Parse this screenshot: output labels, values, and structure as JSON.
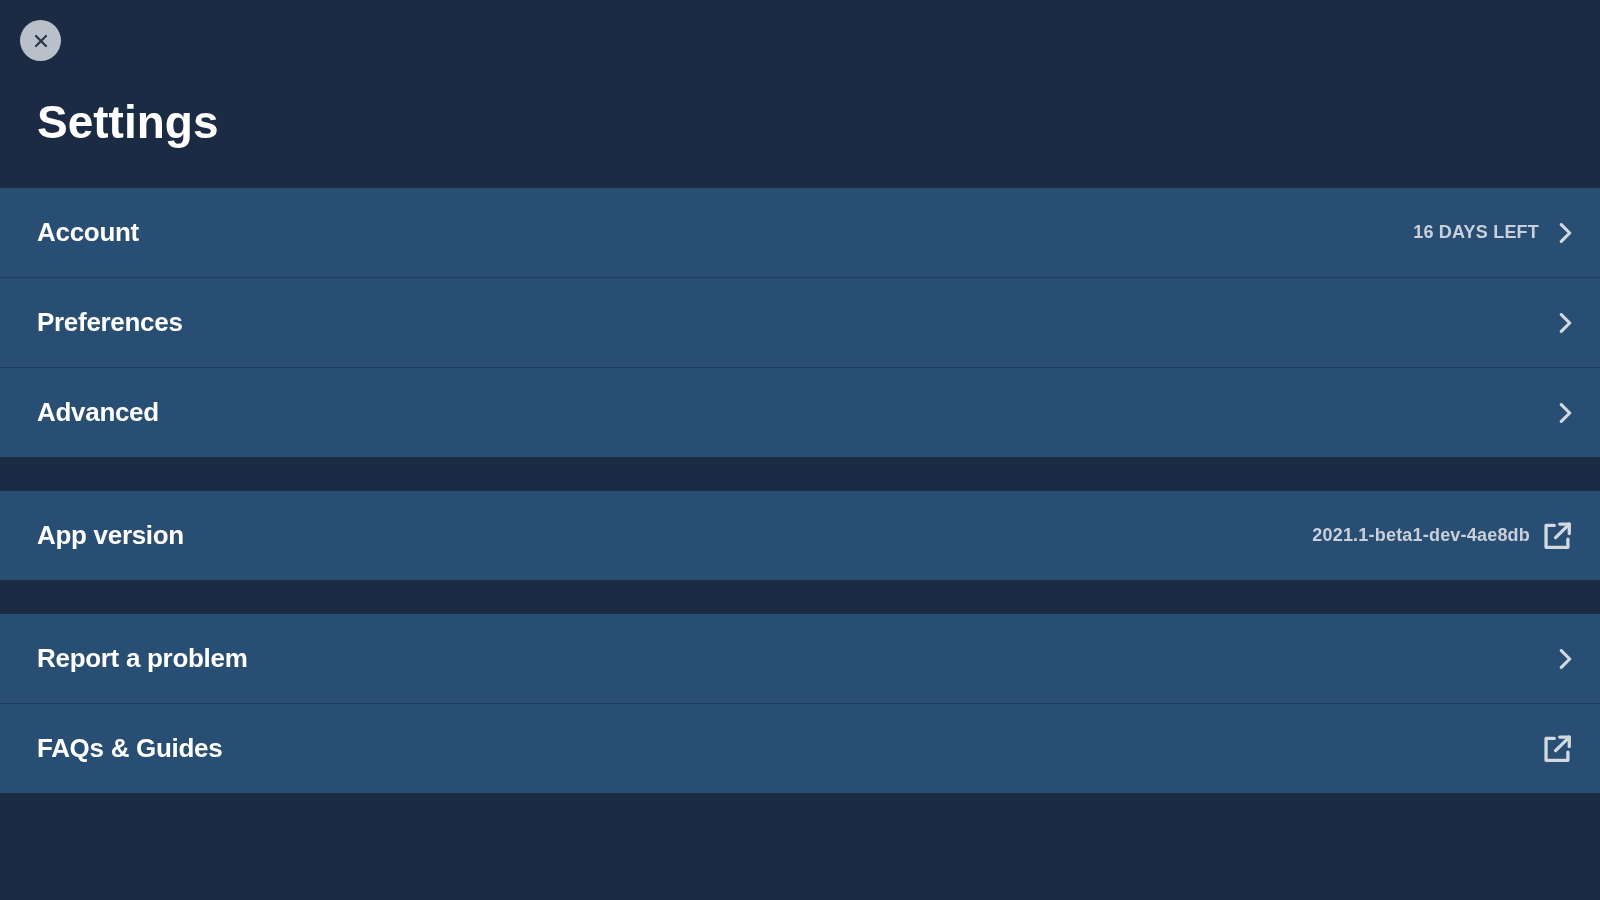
{
  "title": "Settings",
  "groups": [
    {
      "items": [
        {
          "label": "Account",
          "detail": "16 DAYS LEFT",
          "kind": "chevron"
        },
        {
          "label": "Preferences",
          "kind": "chevron"
        },
        {
          "label": "Advanced",
          "kind": "chevron"
        }
      ]
    },
    {
      "items": [
        {
          "label": "App version",
          "detail": "2021.1-beta1-dev-4ae8db",
          "kind": "external"
        }
      ]
    },
    {
      "items": [
        {
          "label": "Report a problem",
          "kind": "chevron"
        },
        {
          "label": "FAQs & Guides",
          "kind": "external"
        }
      ]
    }
  ]
}
